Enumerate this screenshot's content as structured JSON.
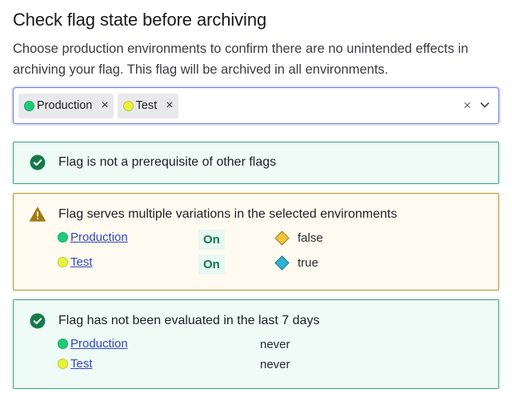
{
  "title": "Check flag state before archiving",
  "description": "Choose production environments to confirm there are no unintended effects in archiving your flag. This flag will be archived in all environments.",
  "environment_select": {
    "selected": [
      {
        "label": "Production",
        "color": "#1ecb7a"
      },
      {
        "label": "Test",
        "color": "#e7f53a"
      }
    ],
    "remove_icon": "×",
    "clear_icon": "×"
  },
  "checks": {
    "prerequisite": {
      "status": "ok",
      "text": "Flag is not a prerequisite of other flags"
    },
    "variations": {
      "status": "warning",
      "text": "Flag serves multiple variations in the selected environments",
      "rows": [
        {
          "env": "Production",
          "env_color": "#1ecb7a",
          "state": "On",
          "variation": "false",
          "variation_color": "#f2c23c"
        },
        {
          "env": "Test",
          "env_color": "#e7f53a",
          "state": "On",
          "variation": "true",
          "variation_color": "#2fb3d3"
        }
      ]
    },
    "evaluation": {
      "status": "ok",
      "text": "Flag has not been evaluated in the last 7 days",
      "rows": [
        {
          "env": "Production",
          "env_color": "#1ecb7a",
          "last_evaluated": "never"
        },
        {
          "env": "Test",
          "env_color": "#e7f53a",
          "last_evaluated": "never"
        }
      ]
    }
  },
  "colors": {
    "success": "#157a4a",
    "warning": "#a47a12",
    "link": "#3446c2",
    "focus": "#6b7de8"
  }
}
